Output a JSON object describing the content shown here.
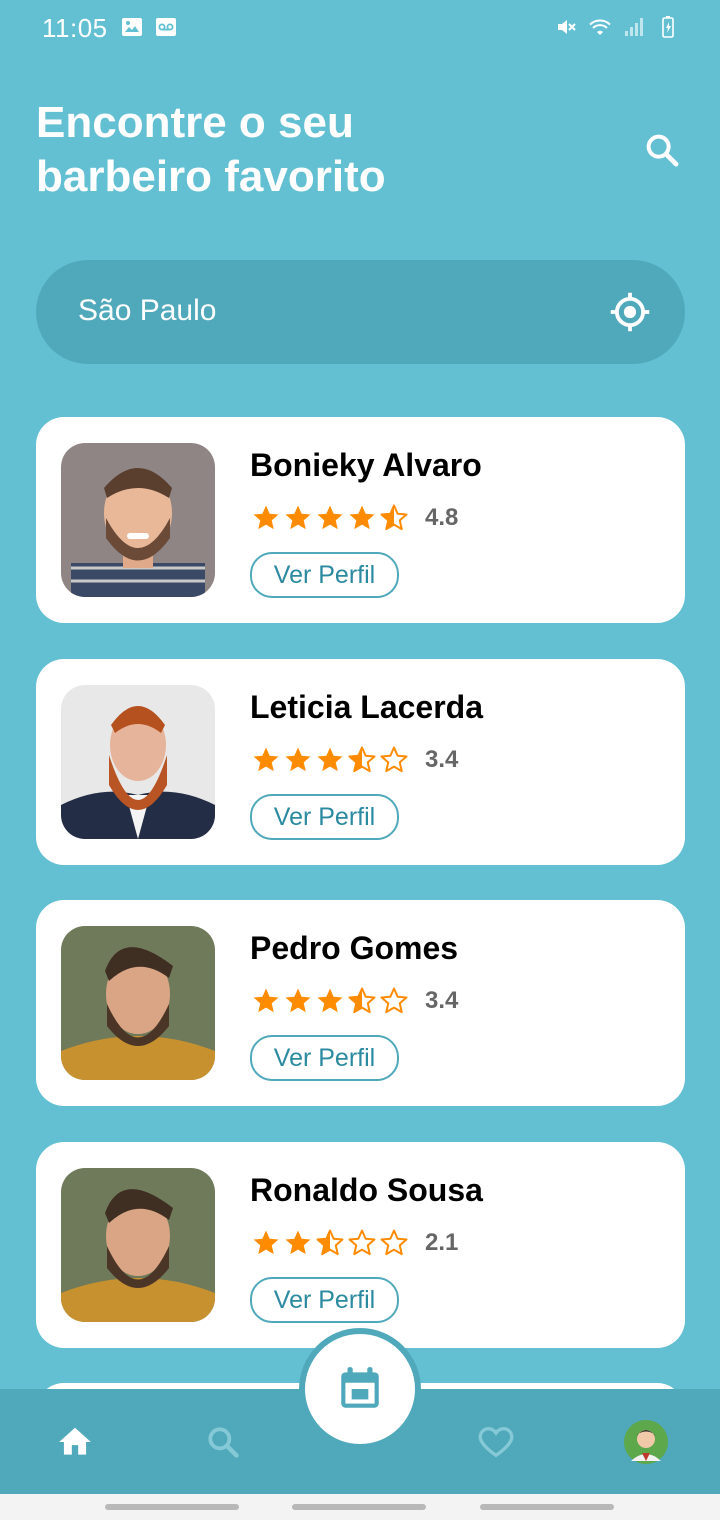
{
  "status_bar": {
    "time": "11:05",
    "left_icons": [
      "image-icon",
      "voicemail-icon"
    ],
    "right_icons": [
      "mute-icon",
      "wifi-icon",
      "signal-icon",
      "battery-icon"
    ]
  },
  "header": {
    "title_line1": "Encontre o seu",
    "title_line2": "barbeiro favorito",
    "search_icon": "search-icon"
  },
  "location": {
    "value": "São Paulo",
    "locate_icon": "my-location-icon"
  },
  "barbers": [
    {
      "name": "Bonieky Alvaro",
      "rating": "4.8",
      "stars": 4.5,
      "button_label": "Ver Perfil"
    },
    {
      "name": "Leticia Lacerda",
      "rating": "3.4",
      "stars": 3.5,
      "button_label": "Ver Perfil"
    },
    {
      "name": "Pedro Gomes",
      "rating": "3.4",
      "stars": 3.5,
      "button_label": "Ver Perfil"
    },
    {
      "name": "Ronaldo Sousa",
      "rating": "2.1",
      "stars": 2.5,
      "button_label": "Ver Perfil"
    }
  ],
  "tab_bar": {
    "items": [
      "home-icon",
      "search-icon",
      "calendar-icon",
      "heart-icon",
      "profile-avatar"
    ]
  },
  "colors": {
    "background": "#63c0d2",
    "primary_dark": "#4fa9bb",
    "star": "#ff8c00",
    "rating_text": "#666666"
  }
}
